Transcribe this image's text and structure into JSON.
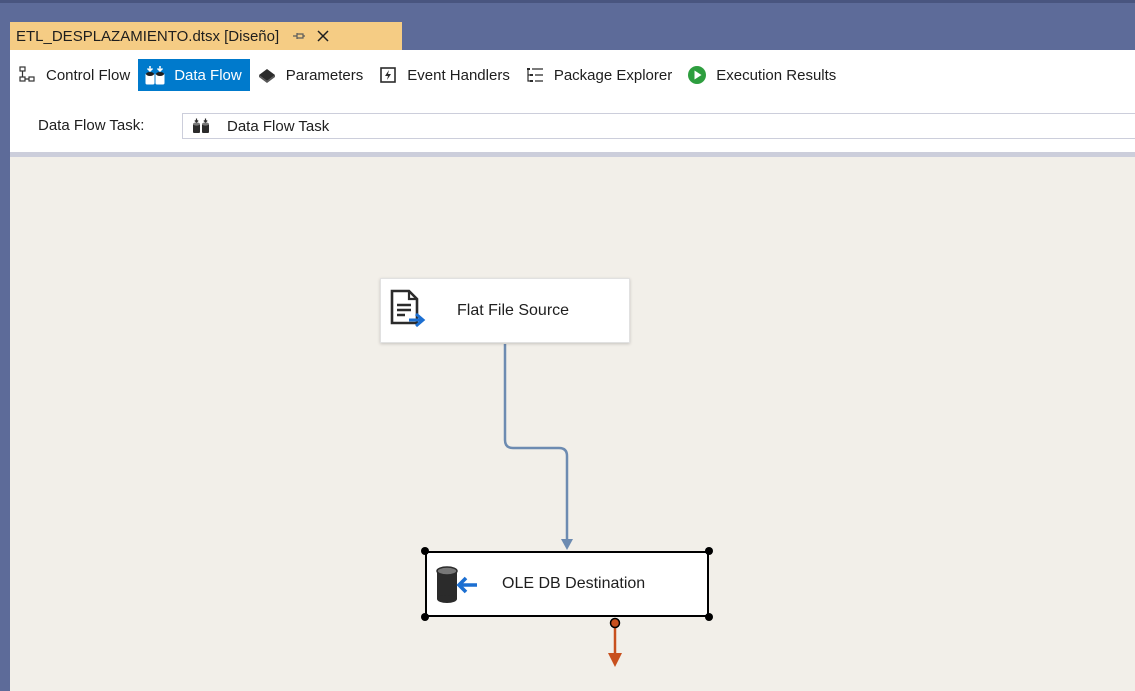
{
  "document_tab": {
    "title": "ETL_DESPLAZAMIENTO.dtsx [Diseño]",
    "pin_icon": "pin-icon",
    "close_icon": "close-icon",
    "background": "#f5cc84"
  },
  "designer_tabs": [
    {
      "label": "Control Flow",
      "icon": "control-flow-icon",
      "active": false
    },
    {
      "label": "Data Flow",
      "icon": "data-flow-icon",
      "active": true
    },
    {
      "label": "Parameters",
      "icon": "parameters-icon",
      "active": false
    },
    {
      "label": "Event Handlers",
      "icon": "event-handlers-icon",
      "active": false
    },
    {
      "label": "Package Explorer",
      "icon": "package-explorer-icon",
      "active": false
    },
    {
      "label": "Execution Results",
      "icon": "execution-results-icon",
      "active": false
    }
  ],
  "task_selector": {
    "label": "Data Flow Task:",
    "value": "Data Flow Task",
    "icon": "data-flow-task-icon"
  },
  "canvas": {
    "components": [
      {
        "label": "Flat File Source",
        "icon": "flat-file-source-icon",
        "selected": false
      },
      {
        "label": "OLE DB Destination",
        "icon": "ole-db-destination-icon",
        "selected": true
      }
    ],
    "connector_color": "#6d8bb1",
    "error_output_color": "#c8501e"
  },
  "colors": {
    "accent": "#007acc",
    "frame": "#5d6b99",
    "canvas": "#f2efe9"
  }
}
